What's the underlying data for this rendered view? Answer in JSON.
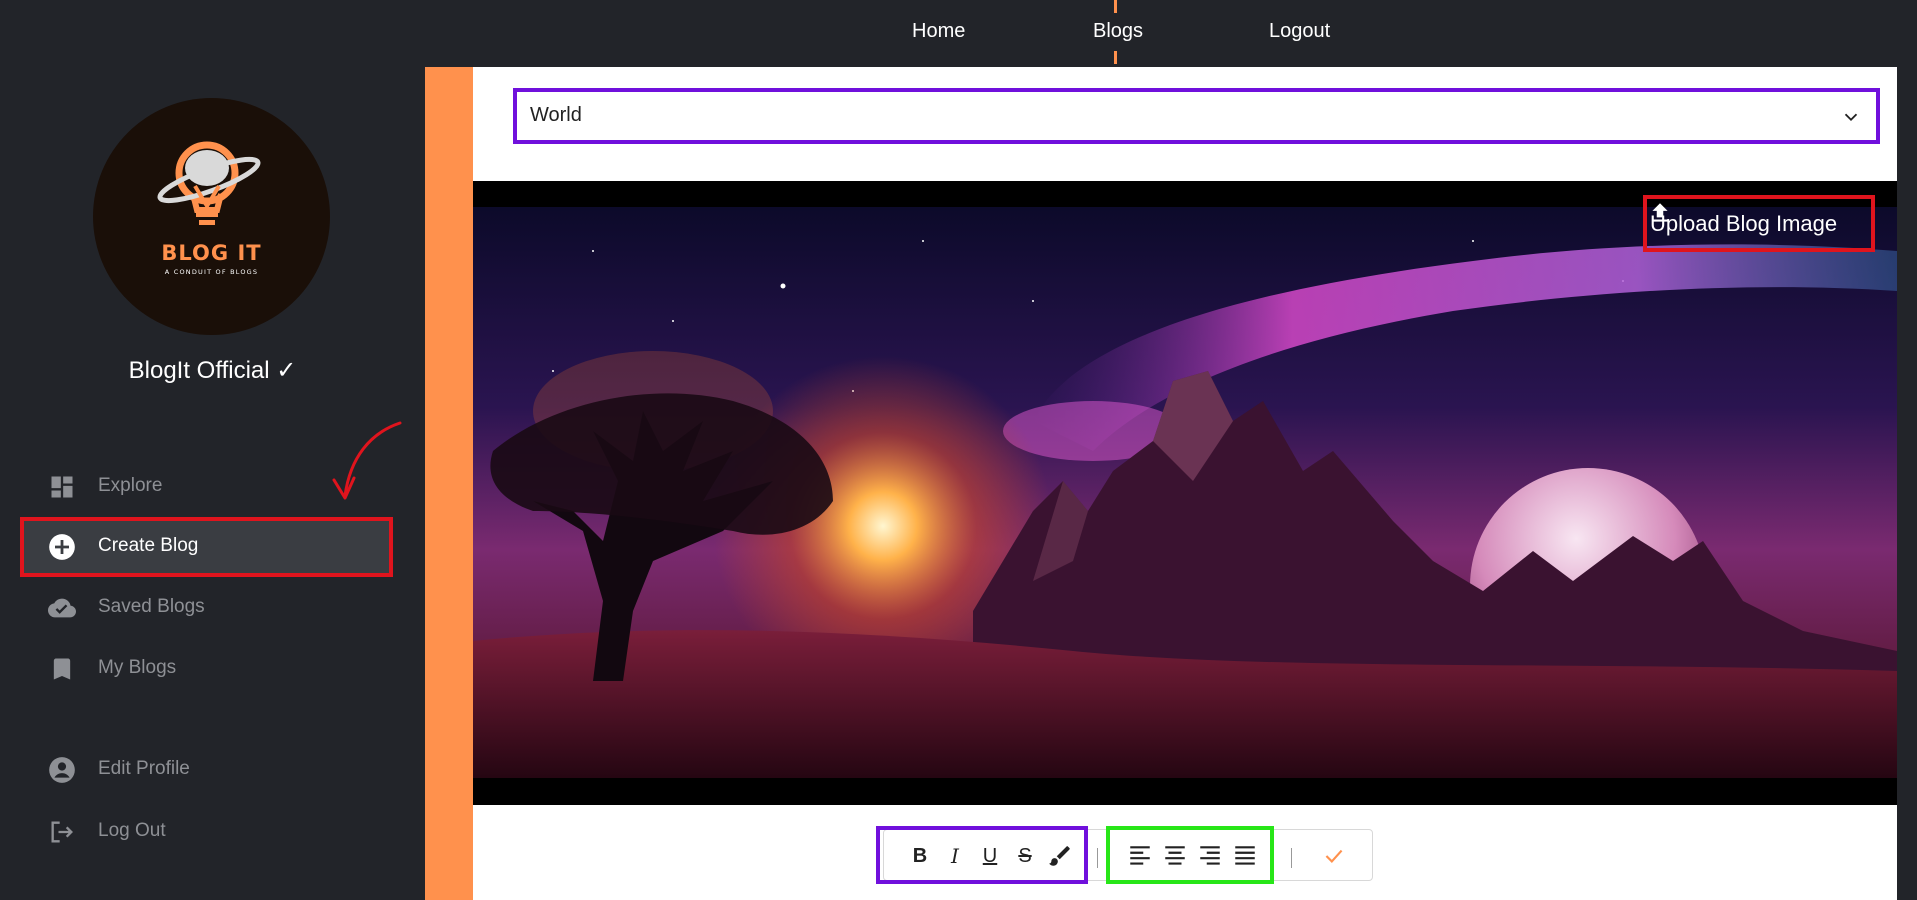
{
  "nav": {
    "links": [
      "Home",
      "Blogs",
      "Logout"
    ],
    "active": "Blogs"
  },
  "sidebar": {
    "logo": {
      "title": "BLOG IT",
      "tagline": "A CONDUIT OF BLOGS"
    },
    "username": "BlogIt Official ✓",
    "items": [
      {
        "label": "Explore",
        "icon": "dashboard-icon"
      },
      {
        "label": "Create Blog",
        "icon": "add-circle-icon",
        "active": true
      },
      {
        "label": "Saved Blogs",
        "icon": "cloud-done-icon"
      },
      {
        "label": "My Blogs",
        "icon": "bookmark-icon"
      },
      {
        "label": "Edit Profile",
        "icon": "account-circle-icon"
      },
      {
        "label": "Log Out",
        "icon": "logout-icon"
      }
    ]
  },
  "editor": {
    "category": {
      "value": "World"
    },
    "upload": {
      "label": "Upload Blog Image",
      "icon": "upload-icon"
    },
    "toolbar": {
      "format": [
        "B",
        "I",
        "U",
        "S",
        "brush-icon"
      ],
      "align": [
        "align-left-icon",
        "align-center-icon",
        "align-right-icon",
        "align-justify-icon"
      ],
      "confirm": "check-icon"
    }
  },
  "colors": {
    "accent": "#ff914d",
    "sidebar_bg": "#222429",
    "highlight_red": "#e0141d",
    "highlight_purple": "#7010dc",
    "highlight_green": "#27e618"
  }
}
